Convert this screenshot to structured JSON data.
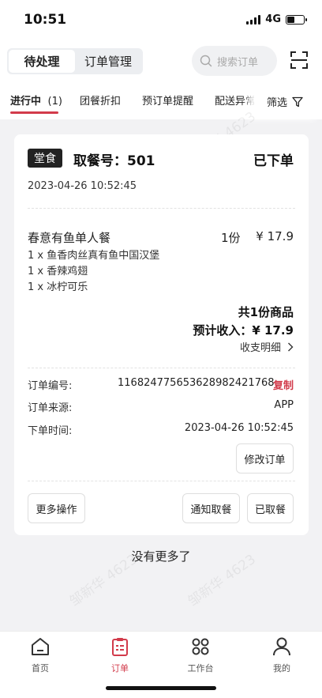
{
  "status_bar": {
    "time": "10:51",
    "network": "4G"
  },
  "header": {
    "segments": [
      {
        "label": "待处理"
      },
      {
        "label": "订单管理"
      }
    ],
    "search_placeholder": "搜索订单"
  },
  "tabs": [
    {
      "label": "进行中",
      "count": "(1)"
    },
    {
      "label": "团餐折扣"
    },
    {
      "label": "预订单提醒"
    },
    {
      "label": "配送异常"
    }
  ],
  "filter_label": "筛选",
  "order": {
    "type_badge": "堂食",
    "pickup_label": "取餐号：501",
    "status": "已下单",
    "created_at": "2023-04-26 10:52:45",
    "item": {
      "name": "春意有鱼单人餐",
      "qty": "1份",
      "price": "¥ 17.9",
      "sub_items": [
        "1 x 鱼香肉丝真有鱼中国汉堡",
        "1 x 香辣鸡翅",
        "1 x 冰柠可乐"
      ]
    },
    "total_count": "共1份商品",
    "expected_income": "预计收入：¥ 17.9",
    "detail_link": "收支明细",
    "info": {
      "order_no_label": "订单编号:",
      "order_no": "1168247756536289824217​68",
      "copy": "复制",
      "source_label": "订单来源:",
      "source": "APP",
      "time_label": "下单时间:",
      "time": "2023-04-26 10:52:45"
    },
    "buttons": {
      "modify": "修改订单",
      "more": "更多操作",
      "notify": "通知取餐",
      "picked": "已取餐"
    }
  },
  "no_more": "没有更多了",
  "watermark": "邹新华 4623",
  "bottom_nav": [
    {
      "label": "首页"
    },
    {
      "label": "订单"
    },
    {
      "label": "工作台"
    },
    {
      "label": "我的"
    }
  ],
  "colors": {
    "accent": "#d23b4b",
    "badge_bg": "#222222"
  }
}
